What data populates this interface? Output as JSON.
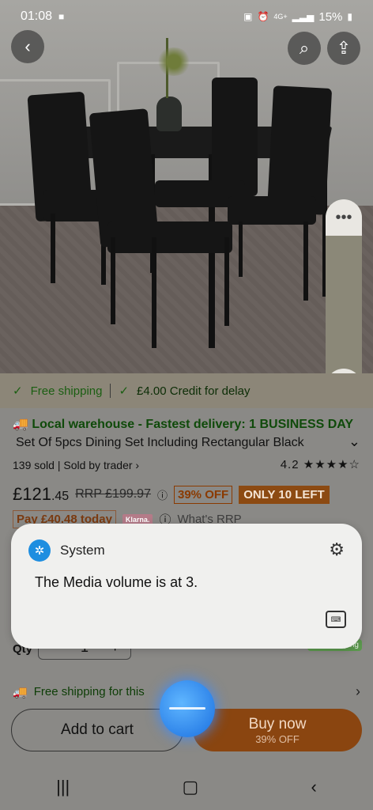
{
  "status": {
    "time": "01:08",
    "network": "4G+",
    "battery": "15%"
  },
  "hero": {
    "back_icon": "back-arrow-icon",
    "search_icon": "search-icon",
    "share_icon": "share-icon"
  },
  "shipping_bar": {
    "free": "Free shipping",
    "credit": "£4.00 Credit for delay"
  },
  "product": {
    "warehouse": "Local warehouse - Fastest delivery: 1 BUSINESS DAY",
    "title": "Set Of 5pcs Dining Set Including Rectangular Black",
    "sold": "139 sold",
    "seller": "Sold by trader",
    "rating": "4.2",
    "stars": "★★★★☆",
    "price_main": "£121",
    "price_dec": ".45",
    "rrp": "RRP £199.97",
    "off": "39% OFF",
    "left": "ONLY 10 LEFT",
    "pay_today": "Pay £40.48 today",
    "klarna": "Klarna.",
    "whats_rrp": "What's RRP"
  },
  "dialog": {
    "app": "System",
    "message": "The Media volume is at 3."
  },
  "qty": {
    "label": "Qty",
    "value": "1",
    "minus": "−",
    "plus": "+"
  },
  "free_tag": "Free shipping",
  "free_line": "Free shipping for this",
  "buttons": {
    "cart": "Add to cart",
    "buy": "Buy now",
    "buy_sub": "39% OFF"
  }
}
